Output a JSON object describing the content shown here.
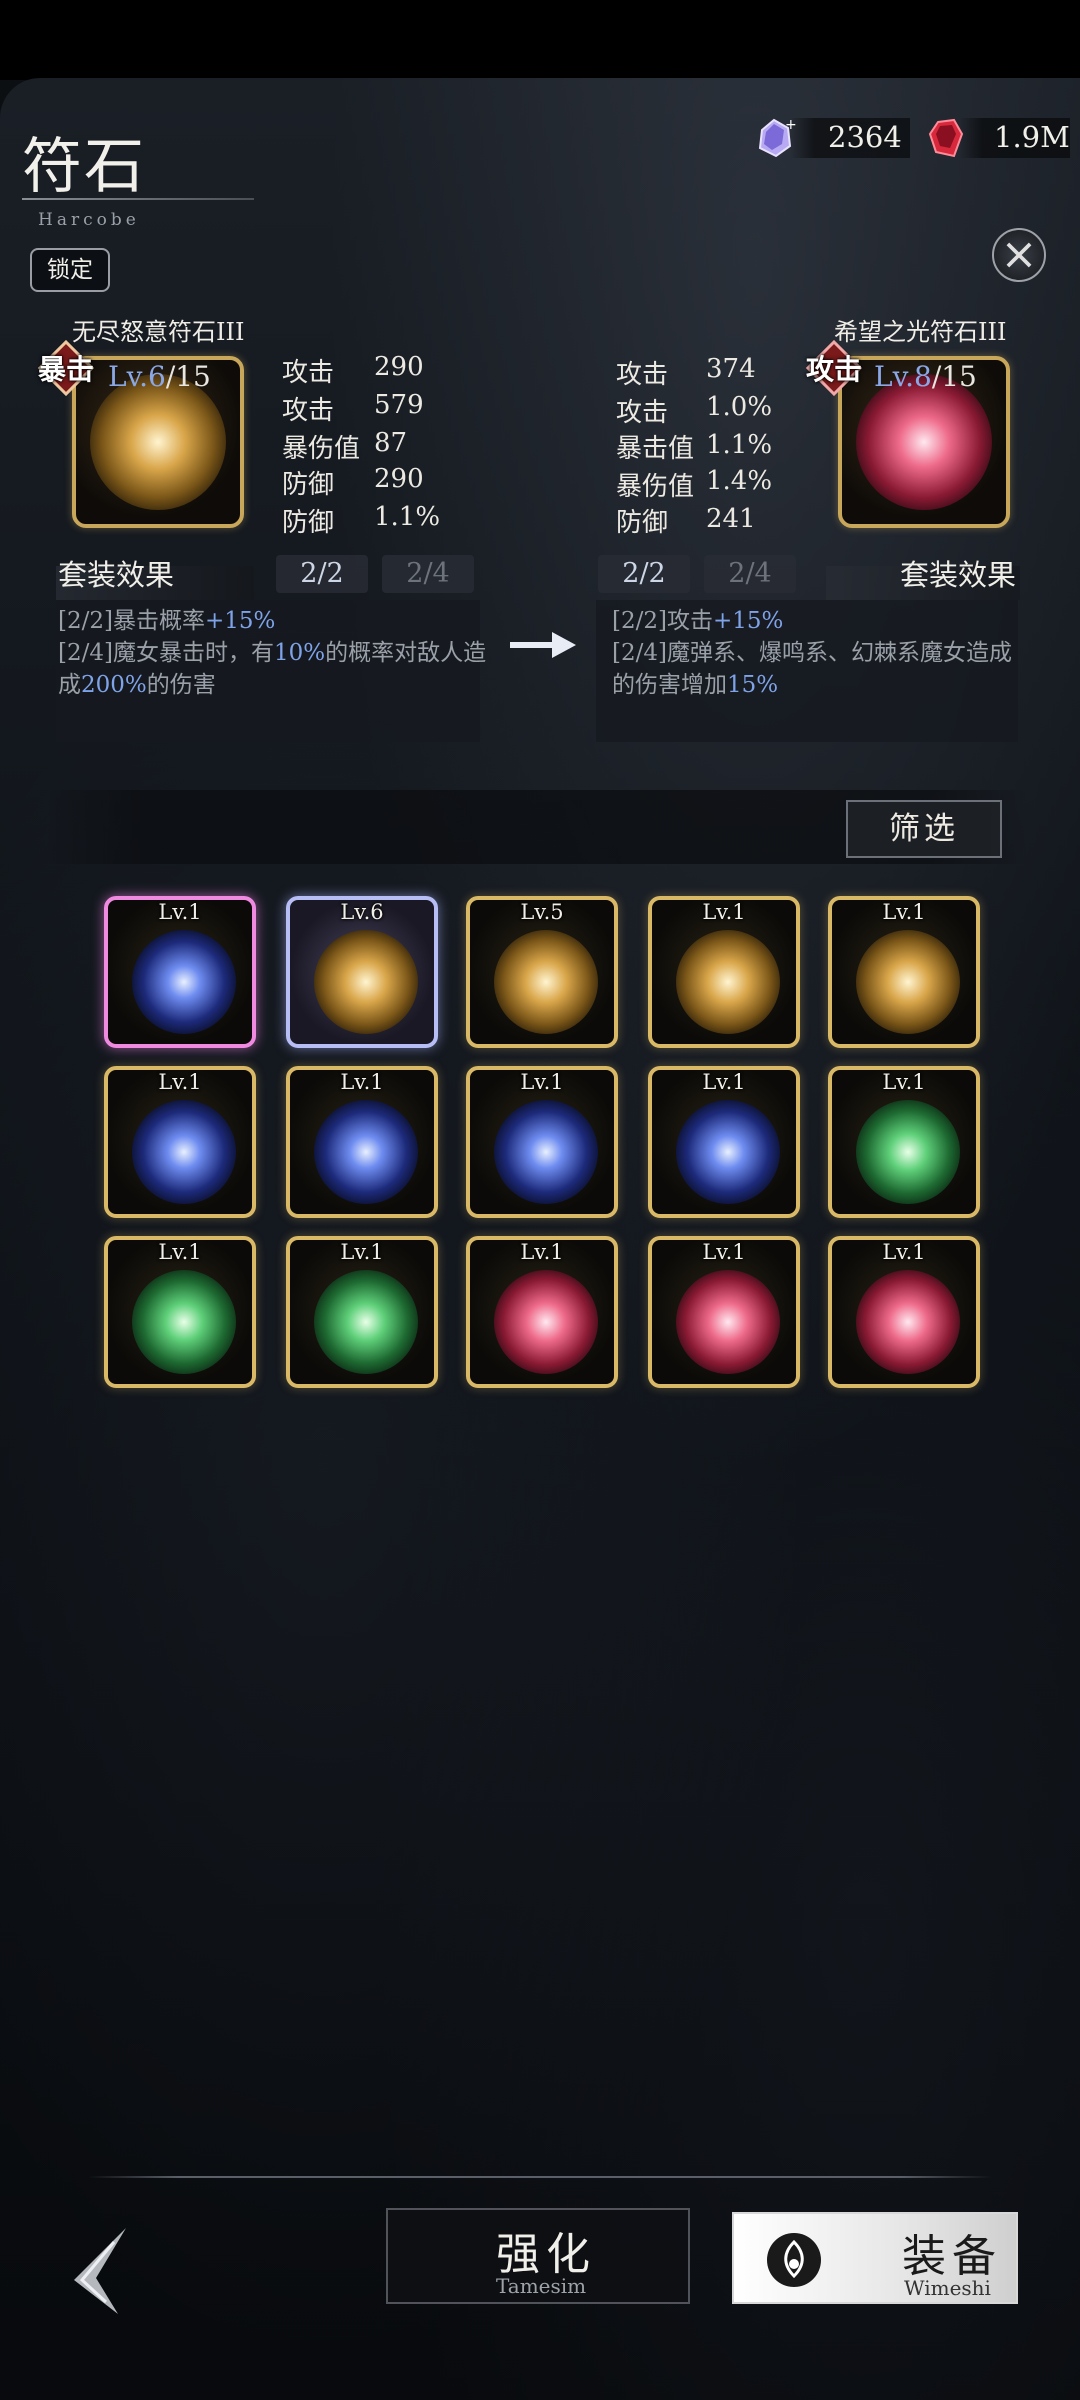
{
  "header": {
    "title": "符石",
    "subtitle": "Harcobe",
    "lock_label": "锁定"
  },
  "currency": [
    {
      "icon": "purple-crystal-icon",
      "value": "2364"
    },
    {
      "icon": "red-gem-icon",
      "value": "1.9M"
    }
  ],
  "left_rune": {
    "name": "无尽怒意符石III",
    "badge": "暴击",
    "level_prefix": "Lv.6",
    "level_suffix": "/15",
    "icon": "fang-rune-icon",
    "stats": [
      {
        "label": "攻击",
        "value": "290"
      },
      {
        "label": "攻击",
        "value": "579"
      },
      {
        "label": "暴伤值",
        "value": "87"
      },
      {
        "label": "防御",
        "value": "290"
      },
      {
        "label": "防御",
        "value": "1.1%"
      }
    ],
    "set_title": "套装效果",
    "tabs": [
      "2/2",
      "2/4"
    ],
    "desc": {
      "l1a": "[2/2]暴击概率",
      "l1b": "+15%",
      "l2a": "[2/4]魔女暴击时，有",
      "l2b": "10%",
      "l2c": "的概率对敌人造",
      "l3a": "成",
      "l3b": "200%",
      "l3c": "的伤害"
    }
  },
  "right_rune": {
    "name": "希望之光符石III",
    "badge": "攻击",
    "level_prefix": "Lv.8",
    "level_suffix": "/15",
    "icon": "swirl-rune-icon",
    "stats": [
      {
        "label": "攻击",
        "value": "374"
      },
      {
        "label": "攻击",
        "value": "1.0%"
      },
      {
        "label": "暴击值",
        "value": "1.1%"
      },
      {
        "label": "暴伤值",
        "value": "1.4%"
      },
      {
        "label": "防御",
        "value": "241"
      }
    ],
    "set_title": "套装效果",
    "tabs": [
      "2/2",
      "2/4"
    ],
    "desc": {
      "l1a": "[2/2]攻击",
      "l1b": "+15%",
      "l2a": "[2/4]魔弹系、爆鸣系、幻棘系魔女造成",
      "l3a": "的伤害增加",
      "l3b": "15%"
    }
  },
  "filter_label": "筛选",
  "inventory": [
    {
      "lv": "Lv.1",
      "type": "blue"
    },
    {
      "lv": "Lv.6",
      "type": "gold"
    },
    {
      "lv": "Lv.5",
      "type": "gold"
    },
    {
      "lv": "Lv.1",
      "type": "gold"
    },
    {
      "lv": "Lv.1",
      "type": "gold"
    },
    {
      "lv": "Lv.1",
      "type": "blue"
    },
    {
      "lv": "Lv.1",
      "type": "blue"
    },
    {
      "lv": "Lv.1",
      "type": "blue"
    },
    {
      "lv": "Lv.1",
      "type": "blue"
    },
    {
      "lv": "Lv.1",
      "type": "green"
    },
    {
      "lv": "Lv.1",
      "type": "green"
    },
    {
      "lv": "Lv.1",
      "type": "green"
    },
    {
      "lv": "Lv.1",
      "type": "red"
    },
    {
      "lv": "Lv.1",
      "type": "red"
    },
    {
      "lv": "Lv.1",
      "type": "red"
    }
  ],
  "buttons": {
    "enhance_main": "强化",
    "enhance_sub": "Tamesim",
    "equip_main": "装备",
    "equip_sub": "Wimeshi"
  },
  "colors": {
    "accent_gold": "#d9b866",
    "highlight_blue": "#7fa3e8",
    "selected_pink": "#f08ae0"
  }
}
